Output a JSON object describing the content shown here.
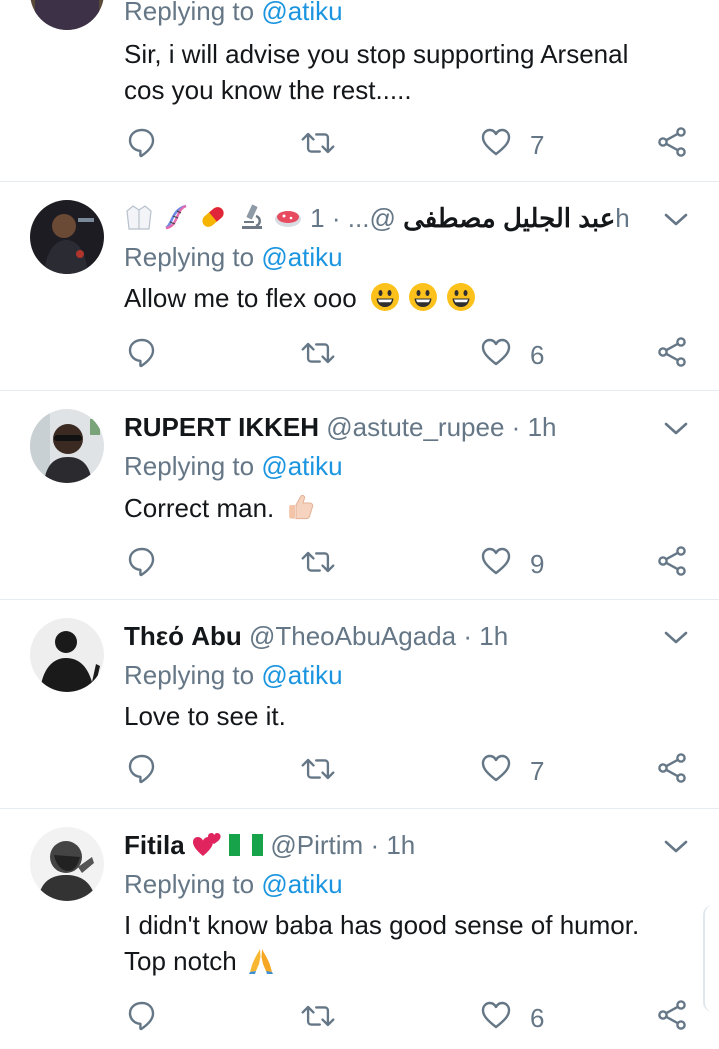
{
  "colors": {
    "link": "#1b95e0",
    "muted": "#657786",
    "text": "#14171a",
    "divider": "#e6ecf0"
  },
  "tweets": [
    {
      "name": "",
      "handle": "",
      "time": "",
      "replying_prefix": "Replying to ",
      "replying_handle": "@atiku",
      "text_lines": [
        "Sir, i will advise you stop supporting Arsenal",
        "cos you know the rest....."
      ],
      "likes": "7"
    },
    {
      "name": "عبد الجليل مصطفى",
      "handle": "@...",
      "dot": "·",
      "time": "1h",
      "name_emojis": [
        "coat-icon",
        "dna-icon",
        "pill-icon",
        "microscope-icon",
        "petri-dish-icon"
      ],
      "replying_prefix": "Replying to ",
      "replying_handle": "@atiku",
      "text_lines": [
        "Allow me to flex ooo"
      ],
      "text_emojis": [
        "grinning-face-icon",
        "grinning-face-icon",
        "grinning-face-icon"
      ],
      "likes": "6"
    },
    {
      "name": "RUPERT IKKEH",
      "handle": "@astute_rupee",
      "dot": "·",
      "time": "1h",
      "replying_prefix": "Replying to ",
      "replying_handle": "@atiku",
      "text_lines": [
        "Correct man."
      ],
      "text_emojis": [
        "thumbs-up-icon"
      ],
      "likes": "9"
    },
    {
      "name": "Thεό Abu",
      "handle": "@TheoAbuAgada",
      "dot": "·",
      "time": "1h",
      "replying_prefix": "Replying to ",
      "replying_handle": "@atiku",
      "text_lines": [
        "Love to see it."
      ],
      "likes": "7"
    },
    {
      "name": "Fitila",
      "handle": "@Pirtim",
      "dot": "·",
      "time": "1h",
      "name_emojis": [
        "two-hearts-icon",
        "nigeria-flag-icon"
      ],
      "replying_prefix": "Replying to ",
      "replying_handle": "@atiku",
      "text_lines": [
        "I didn't know baba has good sense of humor.",
        "Top notch"
      ],
      "text_emojis": [
        "folded-hands-icon"
      ],
      "likes": "6"
    }
  ]
}
